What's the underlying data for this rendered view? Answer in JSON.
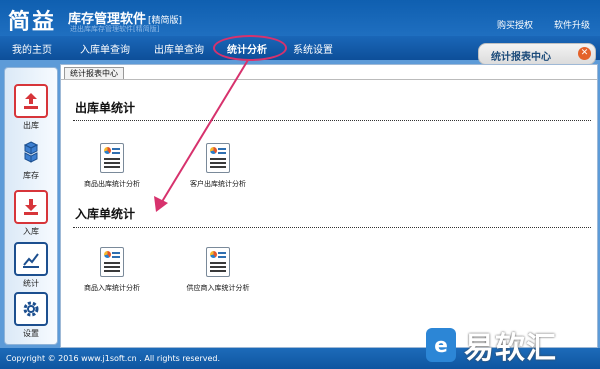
{
  "app": {
    "logo": "简益",
    "title": "库存管理软件",
    "edition": "[精简版]",
    "subtitle": "进出库库存管理软件[精简版]",
    "links": [
      "购买授权",
      "软件升级"
    ]
  },
  "menu": {
    "items": [
      "我的主页",
      "入库单查询",
      "出库单查询",
      "统计分析",
      "系统设置"
    ],
    "active": "统计分析"
  },
  "report_tab": {
    "label": "统计报表中心",
    "close": "✕"
  },
  "sidebar": {
    "items": [
      {
        "label": "出库",
        "icon": "upload-icon"
      },
      {
        "label": "库存",
        "icon": "cubes-icon"
      },
      {
        "label": "入库",
        "icon": "download-icon"
      },
      {
        "label": "统计",
        "icon": "chart-icon"
      },
      {
        "label": "设置",
        "icon": "gear-icon"
      }
    ]
  },
  "content": {
    "tab_label": "统计报表中心",
    "sections": [
      {
        "title": "出库单统计",
        "items": [
          "商品出库统计分析",
          "客户出库统计分析"
        ]
      },
      {
        "title": "入库单统计",
        "items": [
          "商品入库统计分析",
          "供应商入库统计分析"
        ]
      }
    ]
  },
  "footer": {
    "copyright": "Copyright © 2016 www.j1soft.cn . All rights reserved."
  },
  "watermark": {
    "text": "易软汇",
    "icon": "e"
  },
  "colors": {
    "title_bar": "#1462b3",
    "highlight": "#d7326d",
    "accent_red": "#d7353a"
  }
}
